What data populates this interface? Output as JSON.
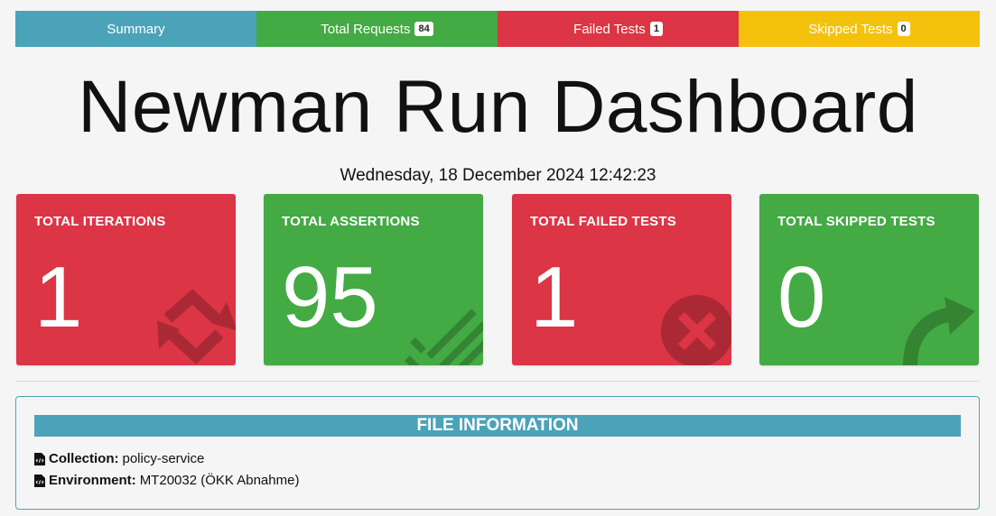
{
  "tabs": {
    "summary": "Summary",
    "total_requests": {
      "label": "Total Requests",
      "count": "84"
    },
    "failed_tests": {
      "label": "Failed Tests",
      "count": "1"
    },
    "skipped_tests": {
      "label": "Skipped Tests",
      "count": "0"
    }
  },
  "header": {
    "title": "Newman Run Dashboard",
    "datetime": "Wednesday, 18 December 2024 12:42:23"
  },
  "cards": [
    {
      "label": "TOTAL ITERATIONS",
      "value": "1",
      "color": "#dc3545",
      "icon": "repeat-icon"
    },
    {
      "label": "TOTAL ASSERTIONS",
      "value": "95",
      "color": "#44aa44",
      "icon": "check-stripes-icon"
    },
    {
      "label": "TOTAL FAILED TESTS",
      "value": "1",
      "color": "#dc3545",
      "icon": "x-circle-icon"
    },
    {
      "label": "TOTAL SKIPPED TESTS",
      "value": "0",
      "color": "#44aa44",
      "icon": "arrow-up-right-icon"
    }
  ],
  "file_info": {
    "heading": "FILE INFORMATION",
    "collection": {
      "label": "Collection:",
      "value": "policy-service"
    },
    "environment": {
      "label": "Environment:",
      "value": "MT20032 (ÖKK Abnahme)"
    }
  },
  "colors": {
    "summary": "#4ba3b9",
    "success": "#44aa44",
    "danger": "#dc3545",
    "warning": "#f4c20d"
  }
}
